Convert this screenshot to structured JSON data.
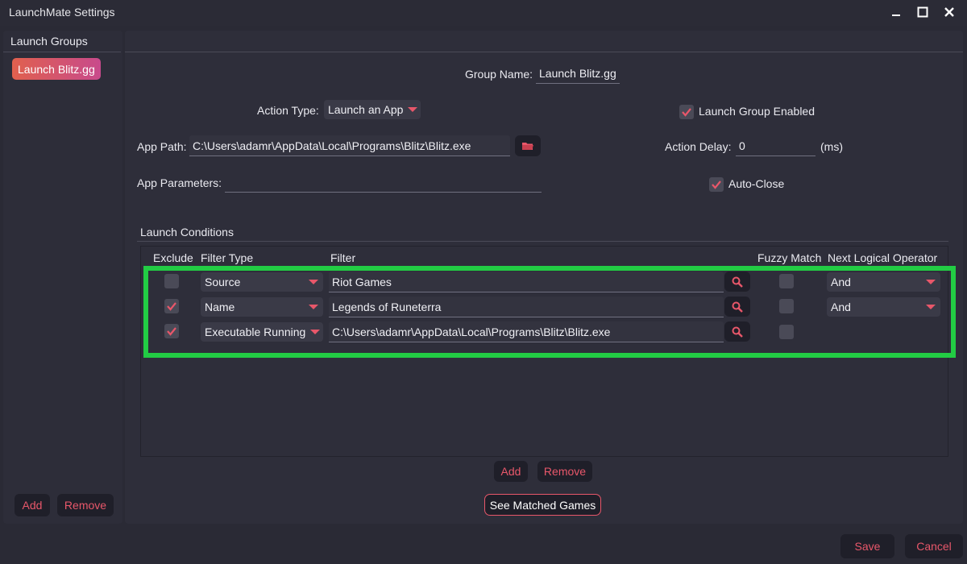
{
  "window": {
    "title": "LaunchMate Settings",
    "minimize_glyph": "–",
    "maximize_glyph": "□",
    "close_glyph": "✕"
  },
  "sidebar": {
    "header": "Launch Groups",
    "items": [
      {
        "label": "Launch Blitz.gg",
        "selected": true
      }
    ],
    "add_label": "Add",
    "remove_label": "Remove"
  },
  "form": {
    "group_name_label": "Group Name:",
    "group_name_value": "Launch Blitz.gg",
    "action_type_label": "Action Type:",
    "action_type_value": "Launch an App",
    "launch_group_enabled_label": "Launch Group Enabled",
    "launch_group_enabled": true,
    "app_path_label": "App Path:",
    "app_path_value": "C:\\Users\\adamr\\AppData\\Local\\Programs\\Blitz\\Blitz.exe",
    "action_delay_label": "Action Delay:",
    "action_delay_value": "0",
    "action_delay_unit": "(ms)",
    "app_parameters_label": "App Parameters:",
    "app_parameters_value": "",
    "auto_close_label": "Auto-Close",
    "auto_close": true
  },
  "conditions": {
    "section_label": "Launch Conditions",
    "columns": [
      "Exclude",
      "Filter Type",
      "Filter",
      "Fuzzy Match",
      "Next Logical Operator"
    ],
    "rows": [
      {
        "exclude": false,
        "filter_type": "Source",
        "filter": "Riot Games",
        "fuzzy": false,
        "operator": "And"
      },
      {
        "exclude": true,
        "filter_type": "Name",
        "filter": "Legends of Runeterra",
        "fuzzy": false,
        "operator": "And"
      },
      {
        "exclude": true,
        "filter_type": "Executable Running",
        "filter": "C:\\Users\\adamr\\AppData\\Local\\Programs\\Blitz\\Blitz.exe",
        "fuzzy": false,
        "operator": ""
      }
    ],
    "add_label": "Add",
    "remove_label": "Remove",
    "see_matched_label": "See Matched Games"
  },
  "footer": {
    "save_label": "Save",
    "cancel_label": "Cancel"
  },
  "colors": {
    "accent": "#e8576a",
    "background": "#2a2a35",
    "highlight": "#22cc44"
  }
}
